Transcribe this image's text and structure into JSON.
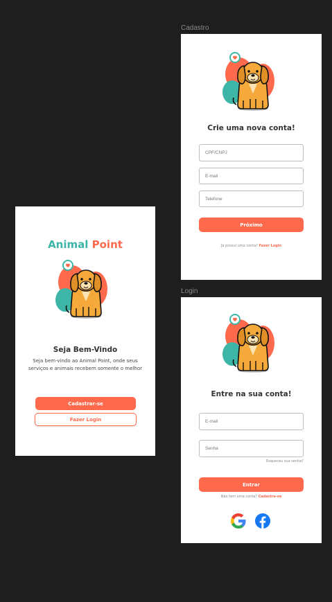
{
  "colors": {
    "accent": "#ff6a4d",
    "teal": "#3db6a8",
    "dog": "#f5a93a",
    "background": "#1e1e1e"
  },
  "frames": {
    "cadastro_label": "Cadastro",
    "login_label": "Login"
  },
  "welcome": {
    "brand_left": "Animal",
    "brand_right": "Point",
    "title": "Seja Bem-Vindo",
    "description_line1": "Seja bem-vindo ao Animal Point, onde seus",
    "description_line2": "serviços e animais recebem somente o melhor",
    "signup_button": "Cadastrar-se",
    "login_button": "Fazer Login"
  },
  "cadastro": {
    "title": "Crie uma nova conta!",
    "fields": {
      "cpf": "CPF/CNPJ",
      "email": "E-mail",
      "phone": "Telefone"
    },
    "next_button": "Próximo",
    "have_account": "Já possui uma conta?",
    "login_link": "Fazer Login"
  },
  "login": {
    "title": "Entre na sua conta!",
    "fields": {
      "email": "E-mail",
      "password": "Senha"
    },
    "forgot": "Esqueceu sua senha?",
    "enter_button": "Entrar",
    "no_account": "Não tem uma conta?",
    "signup_link": "Cadastre-se",
    "social": [
      "google-icon",
      "facebook-icon"
    ]
  }
}
